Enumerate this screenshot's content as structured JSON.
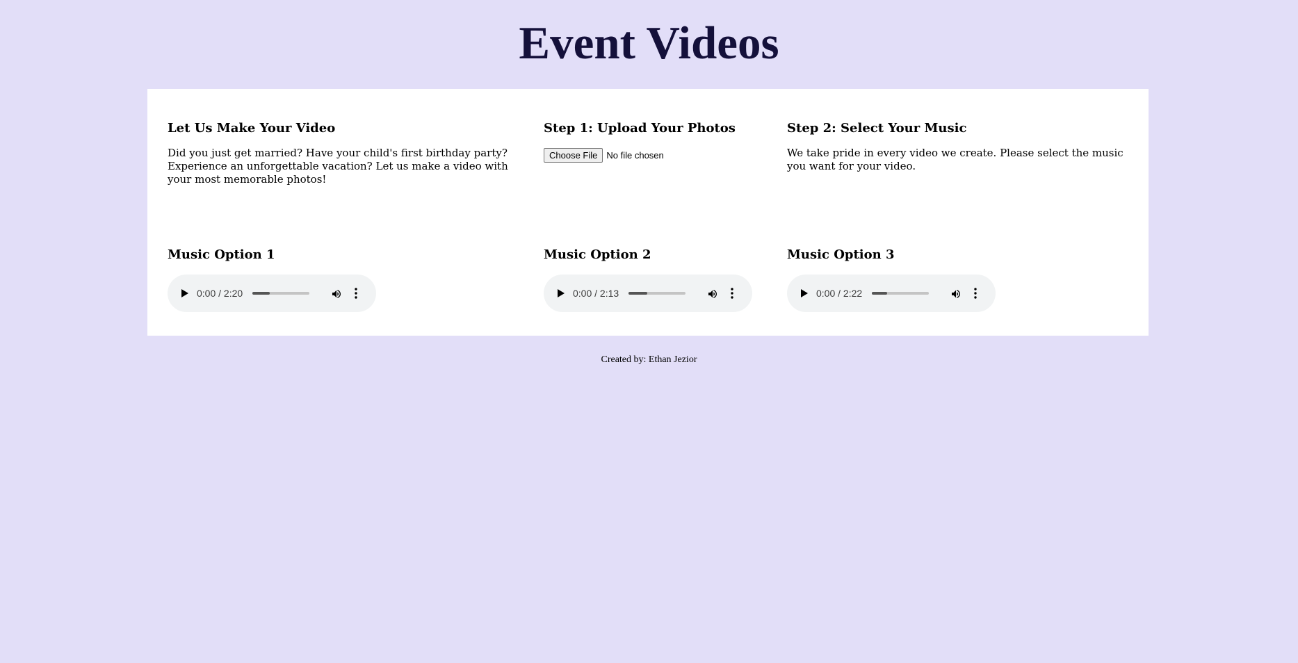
{
  "header": {
    "title": "Event Videos"
  },
  "intro": {
    "heading": "Let Us Make Your Video",
    "body": "Did you just get married? Have your child's first birthday party? Experience an unforgettable vacation? Let us make a video with your most memorable photos!"
  },
  "upload": {
    "heading": "Step 1: Upload Your Photos",
    "button_label": "Choose File",
    "status": "No file chosen"
  },
  "music_select": {
    "heading": "Step 2: Select Your Music",
    "body": "We take pride in every video we create. Please select the music you want for your video."
  },
  "music_options": [
    {
      "heading": "Music Option 1",
      "time": "0:00 / 2:20",
      "progress_fraction": 0.3
    },
    {
      "heading": "Music Option 2",
      "time": "0:00 / 2:13",
      "progress_fraction": 0.33
    },
    {
      "heading": "Music Option 3",
      "time": "0:00 / 2:22",
      "progress_fraction": 0.27
    }
  ],
  "icons": {
    "play": "play-icon",
    "volume": "volume-icon",
    "more": "more-options-icon"
  },
  "colors": {
    "background": "#e2def8",
    "panel": "#ffffff",
    "title": "#14103a",
    "player": "#f1f3f4"
  },
  "footer": {
    "credit": "Created by: Ethan Jezior"
  }
}
